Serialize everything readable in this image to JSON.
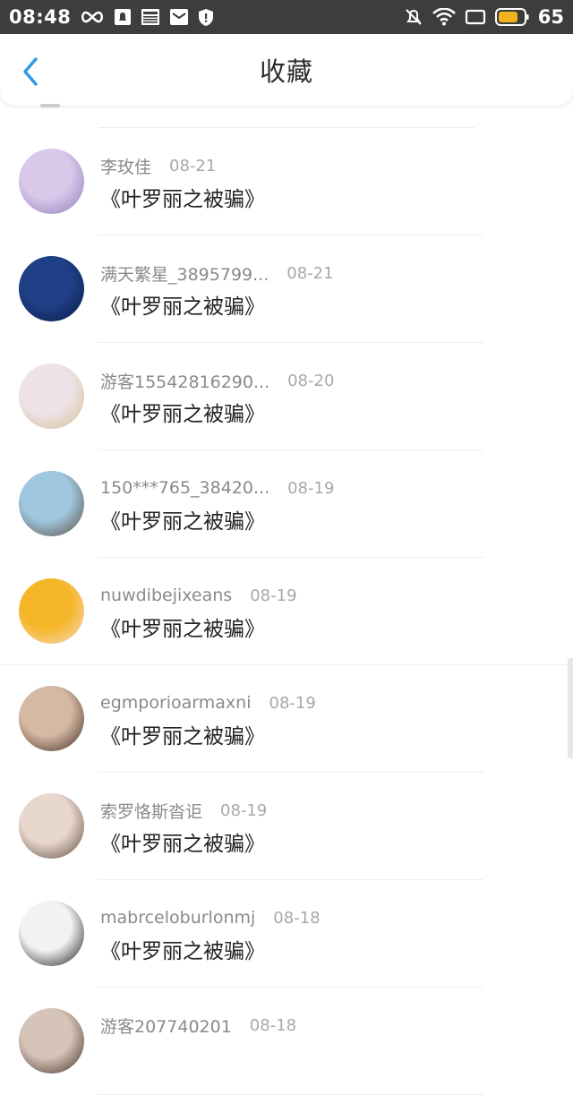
{
  "status_bar": {
    "time": "08:48",
    "battery_level": "65",
    "icons": [
      "loop-icon",
      "notification-icon",
      "news-icon",
      "mail-icon",
      "shield-icon",
      "mute-icon",
      "wifi-icon",
      "screen-icon",
      "battery-icon"
    ]
  },
  "header": {
    "title": "收藏",
    "back_icon": "chevron-left-icon"
  },
  "favorites": [
    {
      "user": "李玫佳",
      "date": "08-21",
      "book": "《叶罗丽之被骗》",
      "avatar_colors": [
        "#d9c8ea",
        "#8d79b8"
      ]
    },
    {
      "user": "满天繁星_3895799...",
      "date": "08-21",
      "book": "《叶罗丽之被骗》",
      "avatar_colors": [
        "#1f3f86",
        "#0a1a44"
      ]
    },
    {
      "user": "游客15542816290...",
      "date": "08-20",
      "book": "《叶罗丽之被骗》",
      "avatar_colors": [
        "#efe3e9",
        "#d3bd8f"
      ]
    },
    {
      "user": "150***765_38420...",
      "date": "08-19",
      "book": "《叶罗丽之被骗》",
      "avatar_colors": [
        "#9fc7df",
        "#5a4a3e"
      ]
    },
    {
      "user": "nuwdibejixeans",
      "date": "08-19",
      "book": "《叶罗丽之被骗》",
      "avatar_colors": [
        "#f5b629",
        "#f7d9c5"
      ]
    },
    {
      "user": "egmporioarmaxni",
      "date": "08-19",
      "book": "《叶罗丽之被骗》",
      "avatar_colors": [
        "#d6b9a3",
        "#3b2a23"
      ]
    },
    {
      "user": "索罗恪斯沓讵",
      "date": "08-19",
      "book": "《叶罗丽之被骗》",
      "avatar_colors": [
        "#e8d7cc",
        "#5b4638"
      ]
    },
    {
      "user": "mabrceloburlonmj",
      "date": "08-18",
      "book": "《叶罗丽之被骗》",
      "avatar_colors": [
        "#f2f2f2",
        "#111111"
      ]
    },
    {
      "user": "游客207740201",
      "date": "08-18",
      "book": "",
      "avatar_colors": [
        "#d7c4b8",
        "#3a2a22"
      ]
    }
  ]
}
